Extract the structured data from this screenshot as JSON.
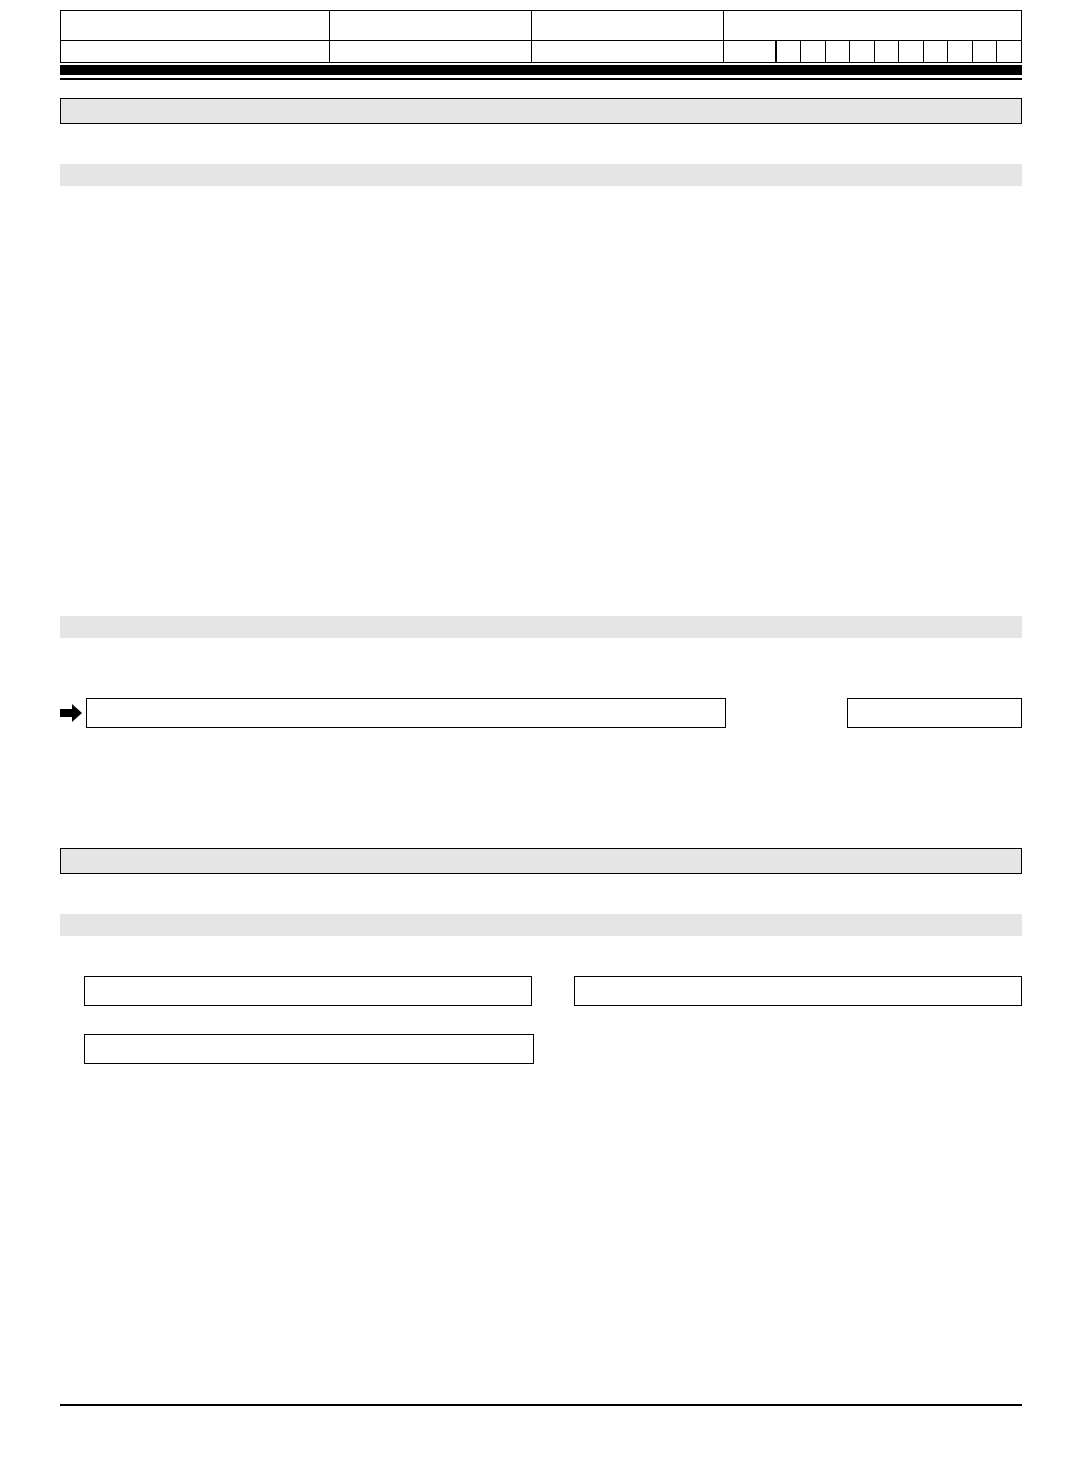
{
  "header": {
    "row1": {
      "cell1": "",
      "cell2": "",
      "cell3": "",
      "cell4": ""
    },
    "row2": {
      "cell1": "",
      "cell2": "",
      "cell3": "",
      "prefix": "",
      "grid": [
        "",
        "",
        "",
        "",
        "",
        "",
        "",
        "",
        "",
        ""
      ]
    }
  },
  "sections": {
    "boxed_header": "",
    "bar1": "",
    "bar2": "",
    "boxed_header2": "",
    "bar3": ""
  },
  "arrow_row": {
    "main_box": "",
    "small_box": ""
  },
  "pairs": {
    "box1": "",
    "box2": "",
    "box3": ""
  }
}
